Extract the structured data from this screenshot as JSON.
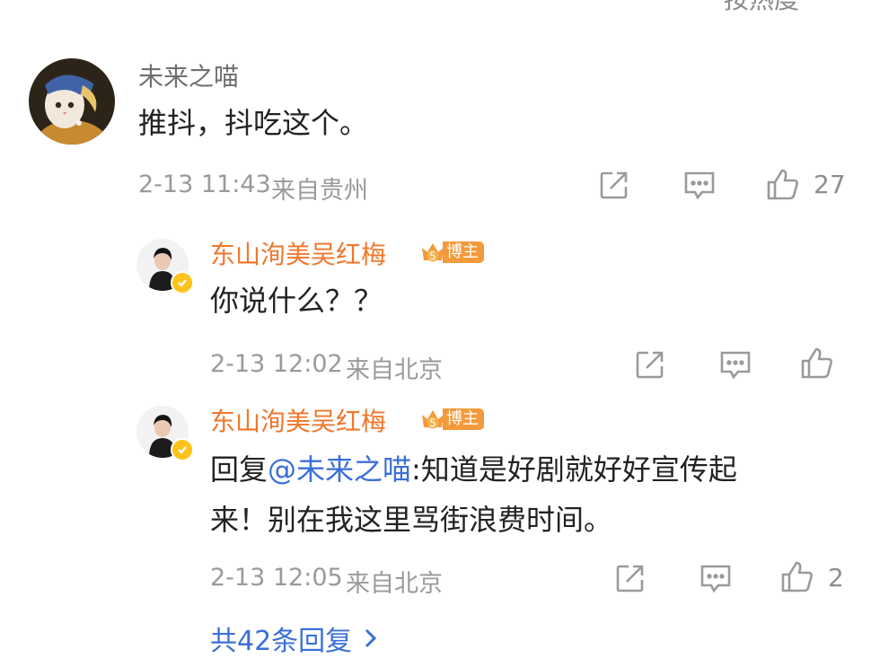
{
  "top_sort_label": "按热度",
  "comment": {
    "username": "未来之喵",
    "text": "推抖，抖吃这个。",
    "time": "2-13 11:43",
    "location": "来自贵州",
    "likes": "27"
  },
  "replies": [
    {
      "username": "东山洵美吴红梅",
      "badge_level": "5",
      "badge_label": "博主",
      "text": "你说什么？？",
      "time": "2-13 12:02",
      "location": "来自北京",
      "likes": ""
    },
    {
      "username": "东山洵美吴红梅",
      "badge_level": "5",
      "badge_label": "博主",
      "reply_prefix": "回复",
      "mention": "@未来之喵",
      "text_line1": ":知道是好剧就好好宣传起",
      "text_line2": "来！别在我这里骂街浪费时间。",
      "time": "2-13 12:05",
      "location": "来自北京",
      "likes": "2"
    }
  ],
  "more_replies_label": "共42条回复",
  "icons": {
    "share": "share-icon",
    "comment": "comment-icon",
    "like": "thumbs-up-icon",
    "more": "chevron-right-icon",
    "verified": "verified-badge-icon",
    "crown": "crown-icon"
  },
  "colors": {
    "blogger_name": "#f0762b",
    "link": "#3b6fd8",
    "meta": "#9a9a9a",
    "badge": "#f39a3a",
    "verified": "#ffc21a"
  }
}
